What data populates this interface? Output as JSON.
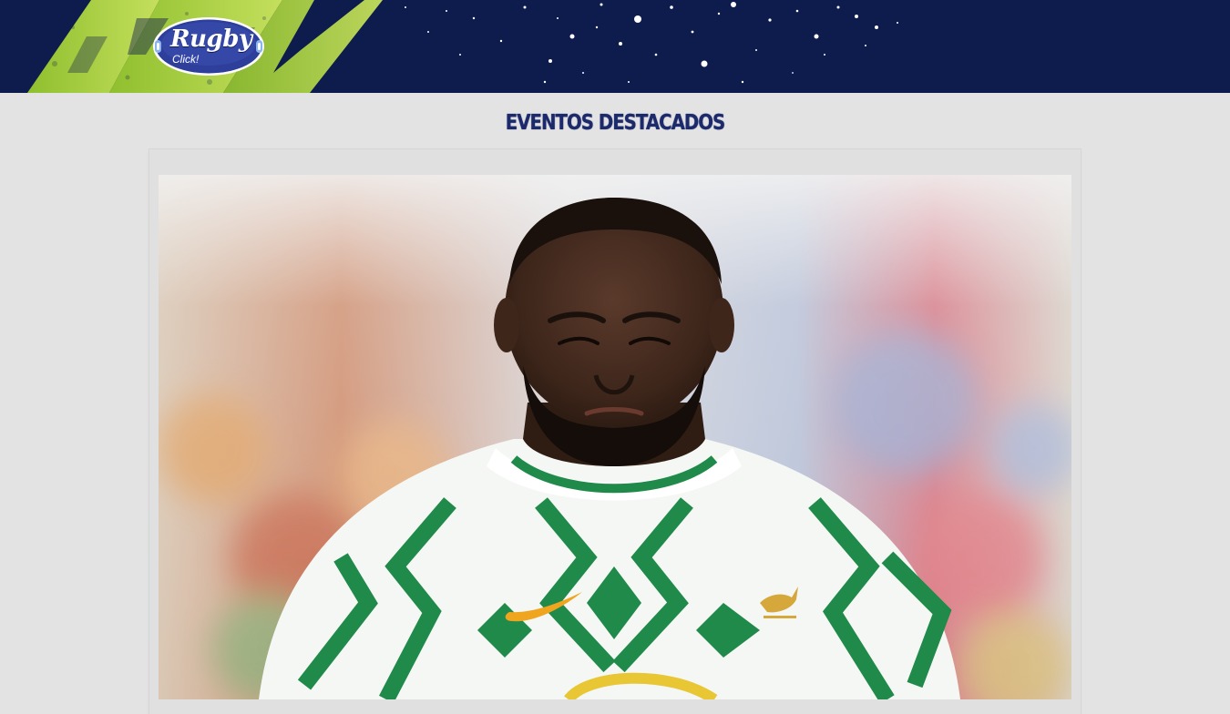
{
  "header": {
    "logo": {
      "title": "Rugby",
      "subtitle": "Click!"
    },
    "colors": {
      "background": "#0e1b4d",
      "accent": "#b6d84a"
    }
  },
  "main": {
    "section_title": "EVENTOS DESTACADOS",
    "featured_event": {
      "image": "rugby-player-photo"
    }
  },
  "colors": {
    "title": "#1c2a6b",
    "page_background": "#e3e3e3"
  }
}
